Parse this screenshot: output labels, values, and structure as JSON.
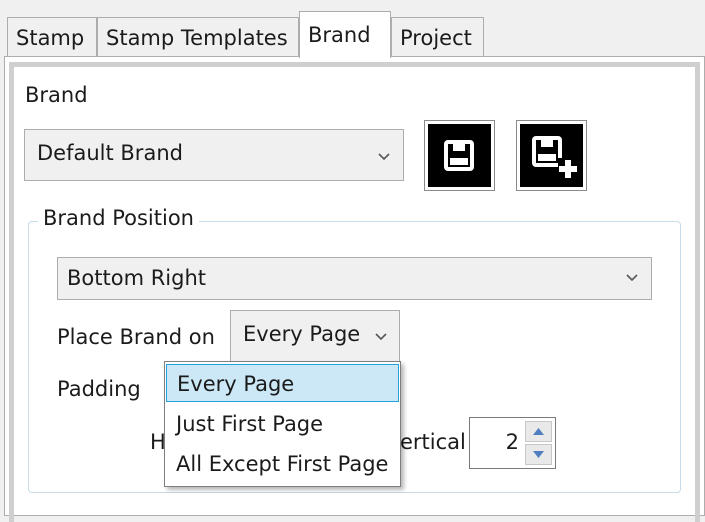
{
  "tabs": [
    {
      "label": "Stamp",
      "active": false
    },
    {
      "label": "Stamp Templates",
      "active": false
    },
    {
      "label": "Brand",
      "active": true
    },
    {
      "label": "Project",
      "active": false
    }
  ],
  "brand": {
    "label": "Brand",
    "selected": "Default Brand",
    "save_icon": "save-icon",
    "save_new_icon": "save-add-icon"
  },
  "position_group": {
    "title": "Brand Position",
    "position_selected": "Bottom Right",
    "place_label": "Place Brand on",
    "place_selected": "Every Page",
    "padding_label": "Padding",
    "horizontal_label": "H",
    "vertical_label": "ertical",
    "vertical_value": "2"
  },
  "place_dropdown": {
    "options": [
      "Every Page",
      "Just First Page",
      "All Except First Page"
    ],
    "selected_index": 0
  },
  "colors": {
    "selection_bg": "#cce8f7",
    "selection_border": "#26a0da",
    "icon_bg": "#000000"
  }
}
